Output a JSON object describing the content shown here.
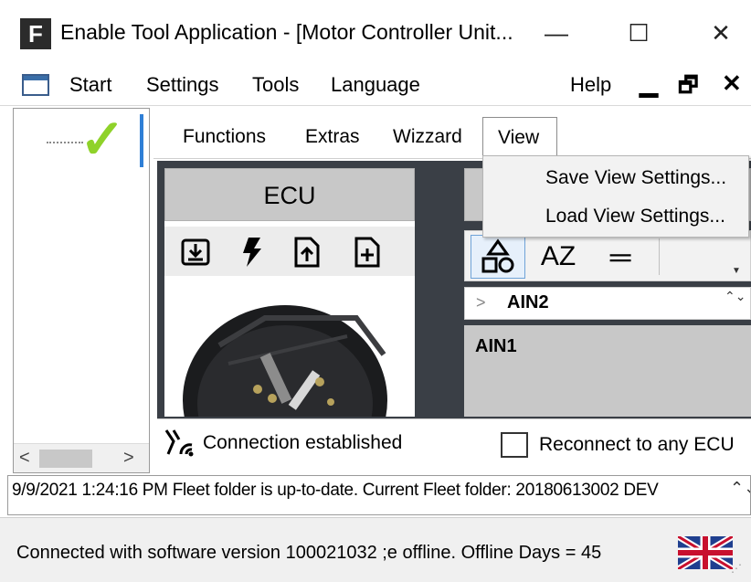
{
  "window": {
    "app_icon_letter": "F",
    "title": "Enable Tool Application - [Motor Controller Unit...",
    "minimize": "—",
    "maximize": "☐",
    "close": "✕"
  },
  "menubar": {
    "items": [
      "Start",
      "Settings",
      "Tools",
      "Language"
    ],
    "help": "Help",
    "mdi_minimize": "▁",
    "mdi_restore": "🗗",
    "mdi_close": "✕"
  },
  "tree": {
    "check_glyph": "✓",
    "scroll_left": "<",
    "scroll_right": ">"
  },
  "tabs": {
    "functions": "Functions",
    "extras": "Extras",
    "wizzard": "Wizzard",
    "view": "View"
  },
  "view_menu": {
    "save": "Save View Settings...",
    "load": "Load View Settings..."
  },
  "ecu": {
    "header": "ECU"
  },
  "properties": {
    "sort_az": "AZ",
    "list_glyph": "═",
    "collapsed_chevron": ">",
    "ain2": "AIN2",
    "ain1": "AIN1",
    "spin": "⌃⌄"
  },
  "connection": {
    "status": "Connection established",
    "reconnect_label": "Reconnect to any ECU",
    "reconnect_checked": false
  },
  "log": {
    "text": "9/9/2021 1:24:16 PM Fleet folder is up-to-date. Current Fleet folder: 20180613002 DEV",
    "scroll": "⌃⌄"
  },
  "statusbar": {
    "text": "Connected with software version 100021032 ;e offline. Offline Days = 45",
    "grip": "⋰"
  },
  "colors": {
    "check_green": "#8fd22a",
    "dark_panel": "#3a3f46",
    "header_gray": "#c8c8c8",
    "selection_blue": "#2f7fd6"
  }
}
